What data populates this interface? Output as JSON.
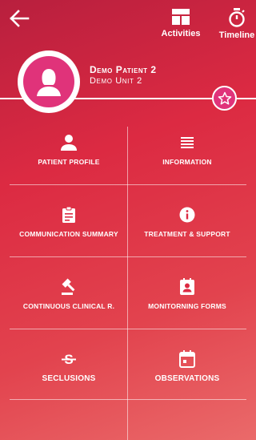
{
  "header": {
    "back_icon": "arrow-left-icon",
    "activities_label": "Activities",
    "activities_icon": "dashboard-icon",
    "timeline_label": "Timeline",
    "timeline_icon": "stopwatch-icon"
  },
  "patient": {
    "name": "Demo Patient 2",
    "unit": "Demo Unit 2",
    "avatar_icon": "person-silhouette-icon",
    "favorite_icon": "star-icon"
  },
  "colors": {
    "accent": "#e0337a",
    "background_top": "#b81f3e",
    "background_bottom": "#ea6a6a"
  },
  "menu": [
    {
      "label": "Patient Profile",
      "icon": "person-icon"
    },
    {
      "label": "Information",
      "icon": "list-icon"
    },
    {
      "label": "Communication Summary",
      "icon": "clipboard-icon"
    },
    {
      "label": "Treatment & Support",
      "icon": "info-icon"
    },
    {
      "label": "Continuous Clinical R.",
      "icon": "gavel-icon"
    },
    {
      "label": "Monitorning Forms",
      "icon": "contact-form-icon"
    },
    {
      "label": "Seclusions",
      "icon": "strikethrough-icon"
    },
    {
      "label": "Observations",
      "icon": "calendar-icon"
    }
  ]
}
